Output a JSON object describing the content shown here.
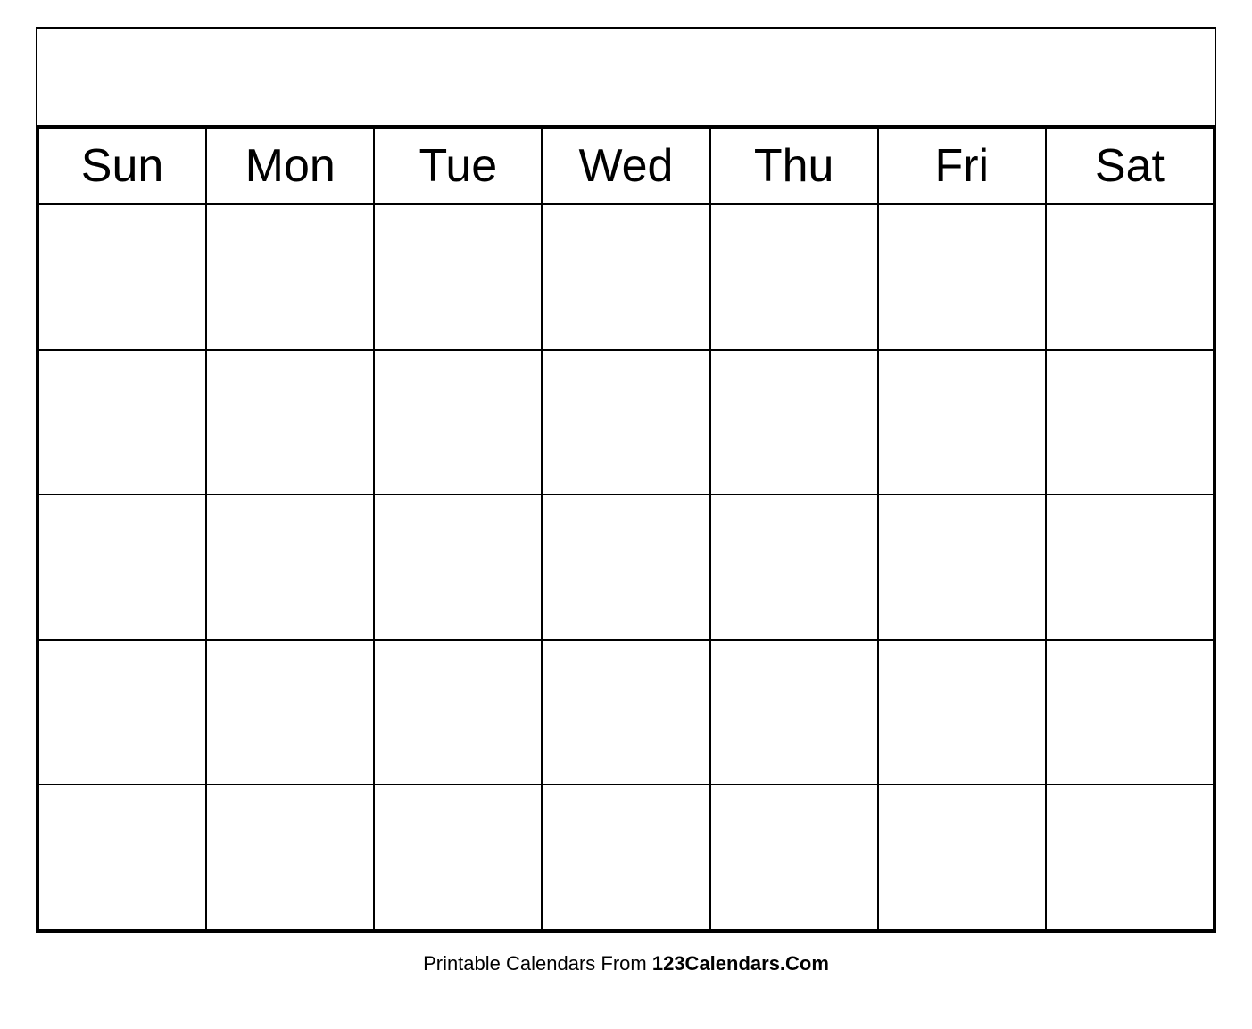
{
  "calendar": {
    "title": "",
    "days": [
      {
        "label": "Sun",
        "key": "sun"
      },
      {
        "label": "Mon",
        "key": "mon"
      },
      {
        "label": "Tue",
        "key": "tue"
      },
      {
        "label": "Wed",
        "key": "wed"
      },
      {
        "label": "Thu",
        "key": "thu"
      },
      {
        "label": "Fri",
        "key": "fri"
      },
      {
        "label": "Sat",
        "key": "sat"
      }
    ],
    "rows": 5
  },
  "footer": {
    "text_normal": "Printable Calendars From ",
    "text_bold": "123Calendars.Com"
  }
}
